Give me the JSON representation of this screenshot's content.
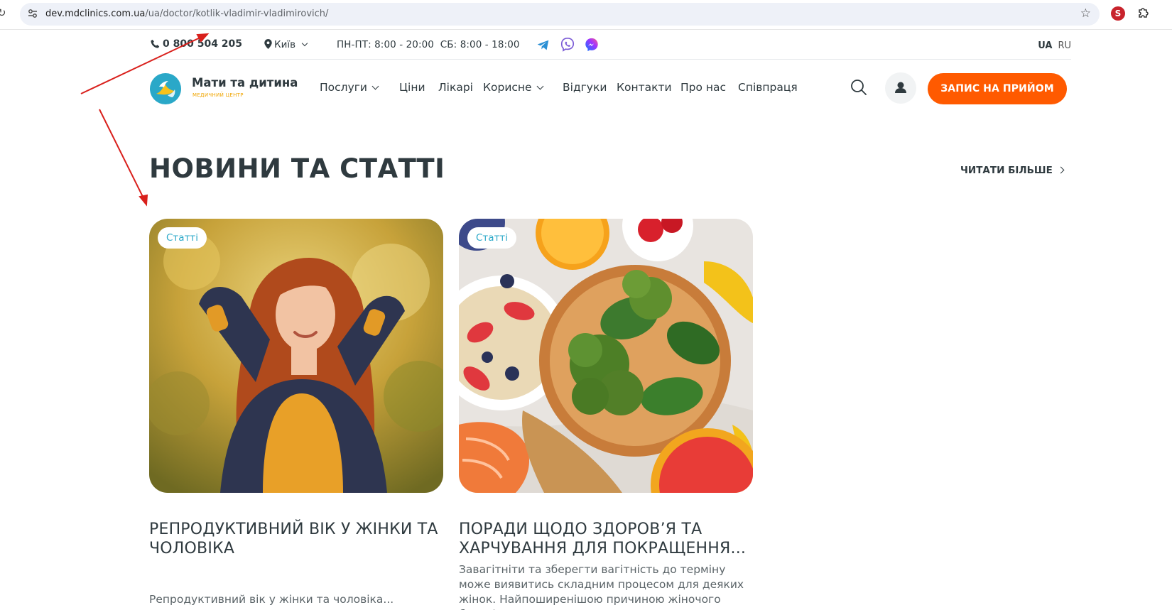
{
  "browser": {
    "url_domain": "dev.mdclinics.com.ua",
    "url_path": "/ua/doctor/kotlik-vladimir-vladimirovich/"
  },
  "topbar": {
    "phone": "0 800 504 205",
    "city": "Київ",
    "hours": "ПН-ПТ: 8:00 - 20:00  СБ: 8:00 - 18:00",
    "lang_ua": "UA",
    "lang_ru": "RU"
  },
  "header": {
    "logo_name": "Мати та дитина",
    "logo_sub": "медичний центр",
    "nav": [
      {
        "label": "Послуги"
      },
      {
        "label": "Ціни"
      },
      {
        "label": "Лікарі"
      },
      {
        "label": "Корисне"
      },
      {
        "label": "Відгуки"
      },
      {
        "label": "Контакти"
      },
      {
        "label": "Про нас"
      },
      {
        "label": "Співпраця"
      }
    ],
    "cta": "ЗАПИС НА ПРИЙОМ"
  },
  "section": {
    "title": "НОВИНИ ТА СТАТТІ",
    "read_more": "ЧИТАТИ БІЛЬШЕ"
  },
  "cards": [
    {
      "tag": "Статті",
      "title": "Репродуктивний вік у жінки та чоловіка",
      "desc": "Репродуктивний вік у жінки та чоловіка..."
    },
    {
      "tag": "Статті",
      "title": "Поради щодо здоров’я та харчування для покращення...",
      "desc": "Завагітніти та зберегти вагітність до терміну може виявитись складним процесом для деяких жінок. Найпоширенішою причиною жіночого безпліддя..."
    }
  ],
  "colors": {
    "accent": "#ff5a00",
    "tag_text": "#2aa8c8",
    "text": "#2f3a3f",
    "annotation": "#d9201c"
  }
}
